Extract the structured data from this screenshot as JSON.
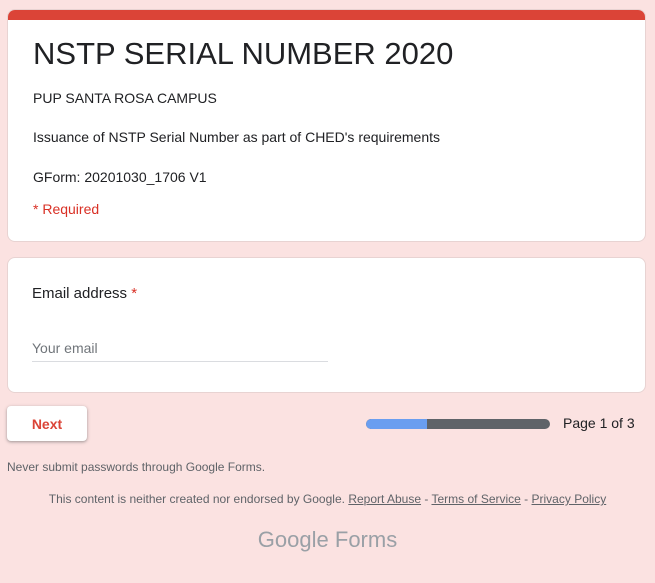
{
  "header": {
    "title": "NSTP SERIAL NUMBER 2020",
    "description_lines": [
      "PUP SANTA ROSA CAMPUS",
      "Issuance of NSTP Serial Number as part of CHED's requirements",
      "GForm: 20201030_1706 V1"
    ],
    "required_note": "* Required",
    "accent_color": "#db4437"
  },
  "question": {
    "label": "Email address",
    "required_marker": "*",
    "placeholder": "Your email",
    "value": ""
  },
  "navigation": {
    "next_label": "Next",
    "page_indicator": "Page 1 of 3",
    "progress_fraction": 0.33,
    "progress_color": "#6a9ef0"
  },
  "footer": {
    "password_warning": "Never submit passwords through Google Forms.",
    "disclaimer": "This content is neither created nor endorsed by Google.",
    "links": [
      "Report Abuse",
      "Terms of Service",
      "Privacy Policy"
    ],
    "separator": " - ",
    "brand_google": "Google",
    "brand_forms": "Forms"
  },
  "colors": {
    "background": "#fbe2e1",
    "required": "#d93025"
  }
}
